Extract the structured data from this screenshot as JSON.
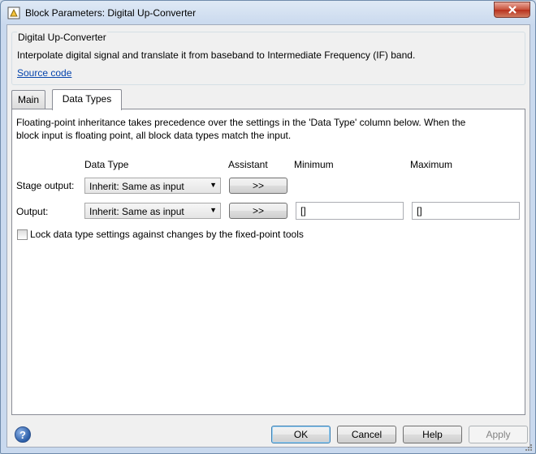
{
  "window": {
    "title": "Block Parameters: Digital Up-Converter"
  },
  "group": {
    "title": "Digital Up-Converter",
    "description": "Interpolate digital signal and translate it from baseband to Intermediate Frequency (IF) band.",
    "link": "Source code"
  },
  "tabs": [
    {
      "label": "Main",
      "active": false
    },
    {
      "label": "Data Types",
      "active": true
    }
  ],
  "panel": {
    "info_line1": "Floating-point inheritance takes precedence over the settings in the 'Data Type' column below. When the",
    "info_line2": "block input is floating point, all block data types match the input.",
    "headers": {
      "data_type": "Data Type",
      "assistant": "Assistant",
      "minimum": "Minimum",
      "maximum": "Maximum"
    },
    "rows": [
      {
        "label": "Stage output:",
        "data_type": "Inherit: Same as input",
        "assistant": ">>"
      },
      {
        "label": "Output:",
        "data_type": "Inherit: Same as input",
        "assistant": ">>",
        "minimum": "[]",
        "maximum": "[]"
      }
    ],
    "lock_label": "Lock data type settings against changes by the fixed-point tools"
  },
  "buttons": {
    "ok": "OK",
    "cancel": "Cancel",
    "help": "Help",
    "apply": "Apply"
  },
  "help_icon_glyph": "?",
  "colors": {
    "link": "#0645ad",
    "titlebar": "#c9d9ee",
    "close": "#c7503a"
  }
}
